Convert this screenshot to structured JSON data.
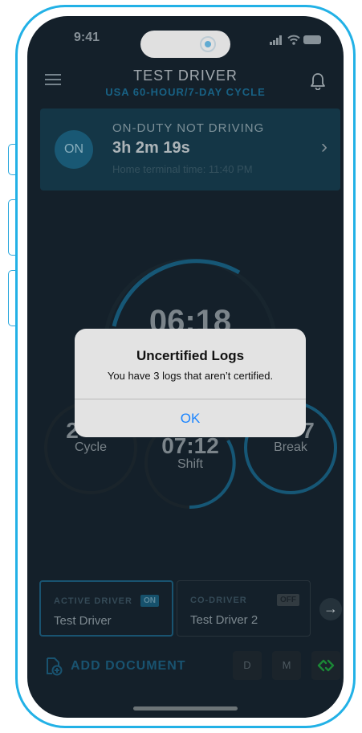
{
  "status_bar": {
    "time": "9:41"
  },
  "header": {
    "driver_name": "TEST DRIVER",
    "cycle": "USA 60-HOUR/7-DAY CYCLE"
  },
  "status_card": {
    "badge": "ON",
    "status": "ON-DUTY NOT DRIVING",
    "duration": "3h 2m 19s",
    "home_terminal": "Home terminal time: 11:40 PM"
  },
  "clocks": {
    "drive_value": "06:18",
    "cycle_value": "2",
    "cycle_label": "Cycle",
    "shift_value": "07:12",
    "shift_label": "Shift",
    "break_value": "7",
    "break_label": "Break"
  },
  "drivers": {
    "active": {
      "tag": "ACTIVE DRIVER",
      "badge": "ON",
      "name": "Test Driver"
    },
    "co": {
      "tag": "CO-DRIVER",
      "badge": "OFF",
      "name": "Test Driver 2"
    }
  },
  "bottom_bar": {
    "add_document": "ADD DOCUMENT",
    "d_button": "D",
    "m_button": "M"
  },
  "alert": {
    "title": "Uncertified Logs",
    "message": "You have 3 logs that aren’t certified.",
    "ok": "OK"
  },
  "colors": {
    "frame": "#22b1e6",
    "screen_bg": "#172530",
    "accent": "#1d6584",
    "link_blue": "#1a84ff",
    "connected_green": "#1f9a3e"
  }
}
